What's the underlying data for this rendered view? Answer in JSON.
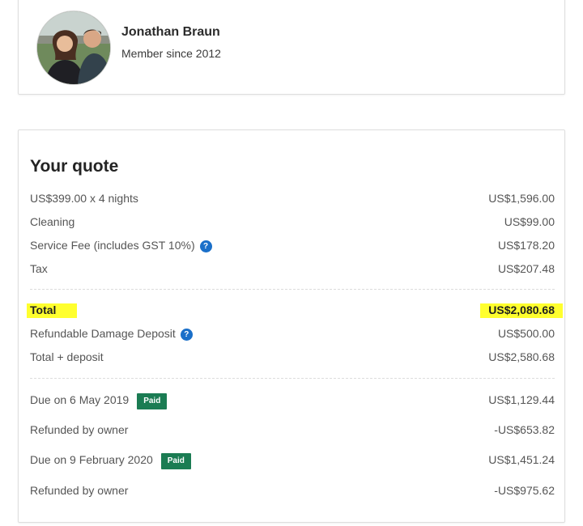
{
  "owner": {
    "name": "Jonathan Braun",
    "member_since": "Member since 2012"
  },
  "quote": {
    "title": "Your quote",
    "lines": [
      {
        "label": "US$399.00 x 4 nights",
        "amount": "US$1,596.00"
      },
      {
        "label": "Cleaning",
        "amount": "US$99.00"
      },
      {
        "label": "Service Fee (includes GST 10%)",
        "amount": "US$178.20"
      },
      {
        "label": "Tax",
        "amount": "US$207.48"
      }
    ],
    "total": {
      "label": "Total",
      "amount": "US$2,080.68"
    },
    "deposit": {
      "label": "Refundable Damage Deposit",
      "amount": "US$500.00"
    },
    "total_plus_deposit": {
      "label": "Total + deposit",
      "amount": "US$2,580.68"
    },
    "payments": [
      {
        "label": "Due on 6 May 2019",
        "badge": "Paid",
        "amount": "US$1,129.44"
      },
      {
        "label": "Refunded by owner",
        "amount": "-US$653.82"
      },
      {
        "label": "Due on 9 February 2020",
        "badge": "Paid",
        "amount": "US$1,451.24"
      },
      {
        "label": "Refunded by owner",
        "amount": "-US$975.62"
      }
    ]
  },
  "icons": {
    "info": "?"
  },
  "colors": {
    "highlight": "#ffff2e",
    "paid_badge": "#1b7c53",
    "info_icon": "#1a6fc9"
  }
}
